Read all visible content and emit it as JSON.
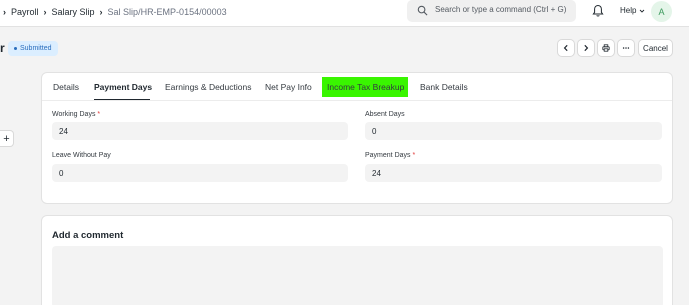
{
  "breadcrumbs": [
    "Payroll",
    "Salary Slip",
    "Sal Slip/HR-EMP-0154/00003"
  ],
  "search": {
    "placeholder": "Search or type a command (Ctrl + G)"
  },
  "nav": {
    "help_label": "Help",
    "avatar_initial": "A"
  },
  "header": {
    "title_fragment": "r",
    "status": "Submitted",
    "cancel_label": "Cancel"
  },
  "side": {
    "add_label": "+"
  },
  "tabs": [
    {
      "label": "Details"
    },
    {
      "label": "Payment Days",
      "active": true
    },
    {
      "label": "Earnings & Deductions"
    },
    {
      "label": "Net Pay Info"
    },
    {
      "label": "Income Tax Breakup",
      "highlighted": true,
      "highlight_color": "#39f500"
    },
    {
      "label": "Bank Details"
    }
  ],
  "fields": {
    "working_days": {
      "label": "Working Days",
      "required": "*",
      "value": "24"
    },
    "absent_days": {
      "label": "Absent Days",
      "value": "0"
    },
    "leave_without_pay": {
      "label": "Leave Without Pay",
      "value": "0"
    },
    "payment_days": {
      "label": "Payment Days",
      "required": "*",
      "value": "24"
    }
  },
  "comment": {
    "title": "Add a comment"
  },
  "colors": {
    "status_bg": "#dbeeff",
    "status_text": "#2a6ebd",
    "highlight": "#39f500"
  },
  "icons": [
    "chevron-right-icon",
    "search-icon",
    "bell-icon",
    "chevron-down-icon",
    "chevron-left-icon",
    "printer-icon",
    "more-icon",
    "plus-icon"
  ]
}
